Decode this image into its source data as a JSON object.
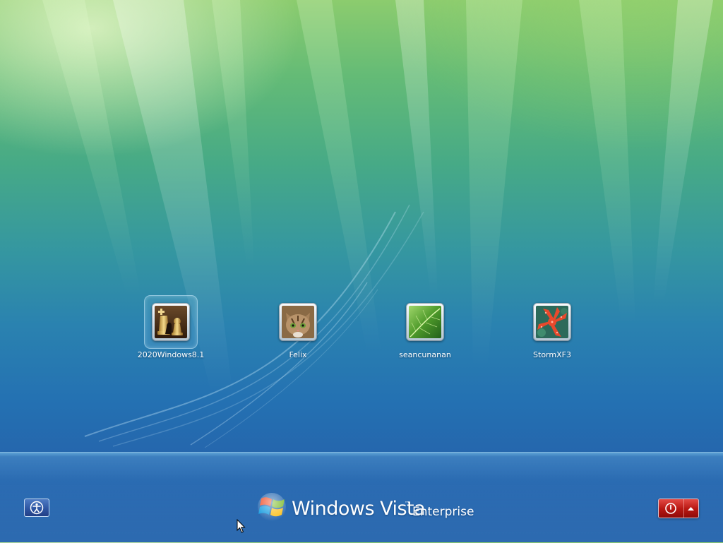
{
  "users": [
    {
      "name": "2020Windows8.1",
      "picture": "chess-pieces",
      "selected": true
    },
    {
      "name": "Felix",
      "picture": "kitten"
    },
    {
      "name": "seancunanan",
      "picture": "green-leaf"
    },
    {
      "name": "StormXF3",
      "picture": "red-starfish"
    }
  ],
  "brand": {
    "product": "Windows Vista",
    "trademark": "™",
    "edition": "Enterprise",
    "logo_icon": "windows-flag-icon"
  },
  "controls": {
    "ease_of_access_icon": "ease-of-access-icon",
    "power_icon": "power-icon",
    "power_menu_icon": "up-arrow-icon"
  },
  "colors": {
    "background_top": "#8ccc6e",
    "background_bottom": "#2566ad",
    "power_button": "#b81813",
    "access_button": "#2e56a3"
  }
}
